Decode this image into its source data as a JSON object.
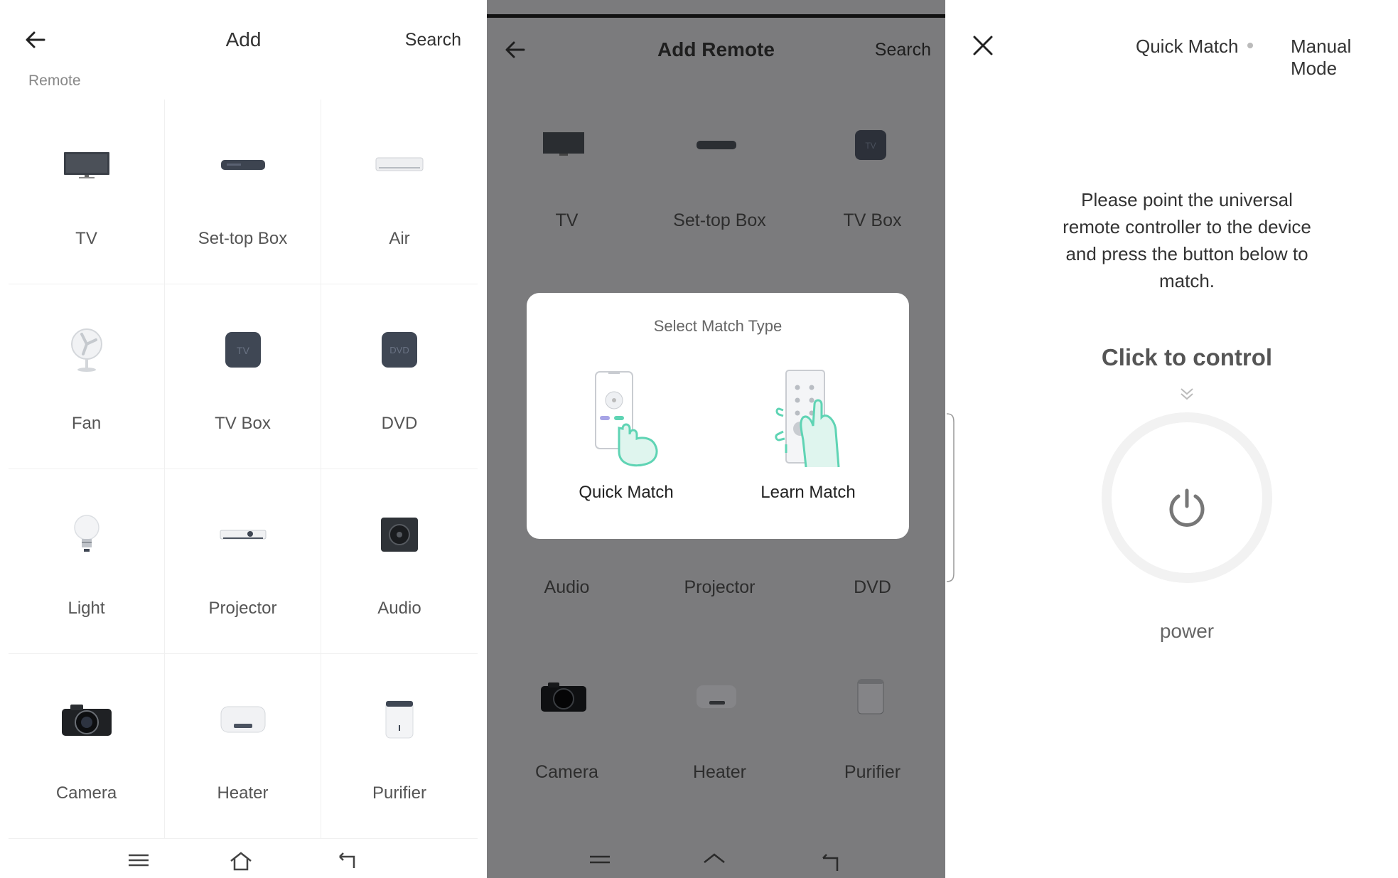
{
  "panel1": {
    "title": "Add",
    "search": "Search",
    "section": "Remote",
    "devices": [
      {
        "label": "TV",
        "icon": "tv-icon"
      },
      {
        "label": "Set-top Box",
        "icon": "set-top-box-icon"
      },
      {
        "label": "Air",
        "icon": "air-conditioner-icon"
      },
      {
        "label": "Fan",
        "icon": "fan-icon"
      },
      {
        "label": "TV Box",
        "icon": "tv-box-icon"
      },
      {
        "label": "DVD",
        "icon": "dvd-icon"
      },
      {
        "label": "Light",
        "icon": "light-bulb-icon"
      },
      {
        "label": "Projector",
        "icon": "projector-icon"
      },
      {
        "label": "Audio",
        "icon": "audio-speaker-icon"
      },
      {
        "label": "Camera",
        "icon": "camera-icon"
      },
      {
        "label": "Heater",
        "icon": "heater-icon"
      },
      {
        "label": "Purifier",
        "icon": "purifier-icon"
      }
    ]
  },
  "panel2": {
    "title": "Add Remote",
    "search": "Search",
    "row1": [
      {
        "label": "TV",
        "icon": "tv-icon"
      },
      {
        "label": "Set-top Box",
        "icon": "set-top-box-icon"
      },
      {
        "label": "TV Box",
        "icon": "tv-box-icon"
      }
    ],
    "row3": [
      {
        "label": "Audio"
      },
      {
        "label": "Projector"
      },
      {
        "label": "DVD"
      }
    ],
    "row4": [
      {
        "label": "Camera",
        "icon": "camera-icon"
      },
      {
        "label": "Heater",
        "icon": "heater-icon"
      },
      {
        "label": "Purifier",
        "icon": "purifier-icon"
      }
    ],
    "dialog": {
      "title": "Select Match Type",
      "quick_match": "Quick Match",
      "learn_match": "Learn Match"
    }
  },
  "panel3": {
    "tab_quick": "Quick Match",
    "tab_manual": "Manual Mode",
    "instruction": "Please point the universal remote controller to the device and press the button below to match.",
    "click_to_control": "Click to control",
    "power_label": "power"
  },
  "colors": {
    "overlay": "#7b7b7d",
    "accent_teal": "#5fd4b4",
    "text_dark": "#333333",
    "ring": "#f2f2f2"
  }
}
